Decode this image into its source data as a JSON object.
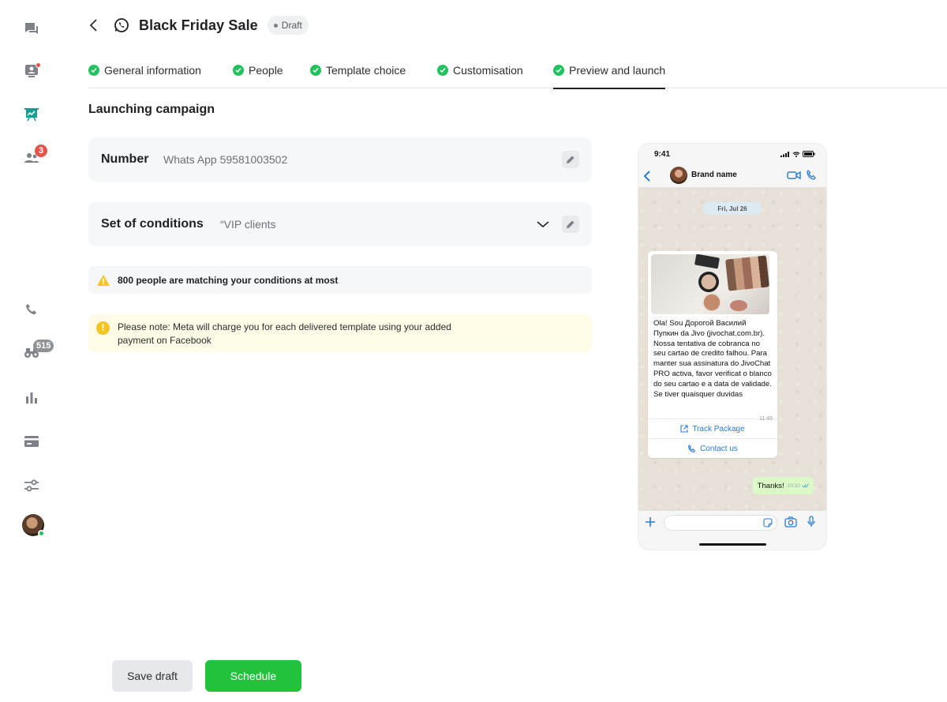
{
  "sidebar": {
    "badges": {
      "contacts": "3",
      "visitors": "515"
    },
    "icons": [
      "chats-icon",
      "agent-monitor-icon",
      "campaigns-icon",
      "team-icon",
      "phone-icon",
      "binoculars-icon",
      "reports-icon",
      "billing-icon",
      "settings-icon"
    ],
    "active": "campaigns-icon",
    "accent": "#1a9c8e"
  },
  "header": {
    "title": "Black Friday Sale",
    "status": "Draft"
  },
  "tabs": [
    {
      "label": "General information",
      "done": true
    },
    {
      "label": "People",
      "done": true
    },
    {
      "label": "Template choice",
      "done": true
    },
    {
      "label": "Customisation",
      "done": true
    },
    {
      "label": "Preview and launch",
      "done": true,
      "active": true
    }
  ],
  "section_title": "Launching campaign",
  "number_card": {
    "label": "Number",
    "value": "Whats App 59581003502"
  },
  "conditions_card": {
    "label": "Set of conditions",
    "value": "“VIP clients"
  },
  "warning": "800 people are matching your conditions at most",
  "note": "Please note: Meta will charge you for each delivered template using your added payment on Facebook",
  "buttons": {
    "save": "Save draft",
    "schedule": "Schedule"
  },
  "phone": {
    "time": "9:41",
    "brand": "Brand name",
    "date": "Fri, Jul 26",
    "message": "Ola! Sou Дорогой Василий Пупкин da Jivo (jivochat.com.br). Nossa tentativa de cobranca no seu cartao de credito falhou. Para manter sua assinatura do JivoChat PRO activa, favor verificat o blanco do seu cartao e a data de validade. Se tiver quaisquer duvidas",
    "message_time": "11:45",
    "actions": [
      "Track Package",
      "Contact us"
    ],
    "reply": "Thanks!",
    "reply_time": "10:10"
  },
  "colors": {
    "success": "#22c35e",
    "primary_button": "#22c23d",
    "link": "#2a7bd4",
    "warning_bg": "#fffbe6"
  }
}
